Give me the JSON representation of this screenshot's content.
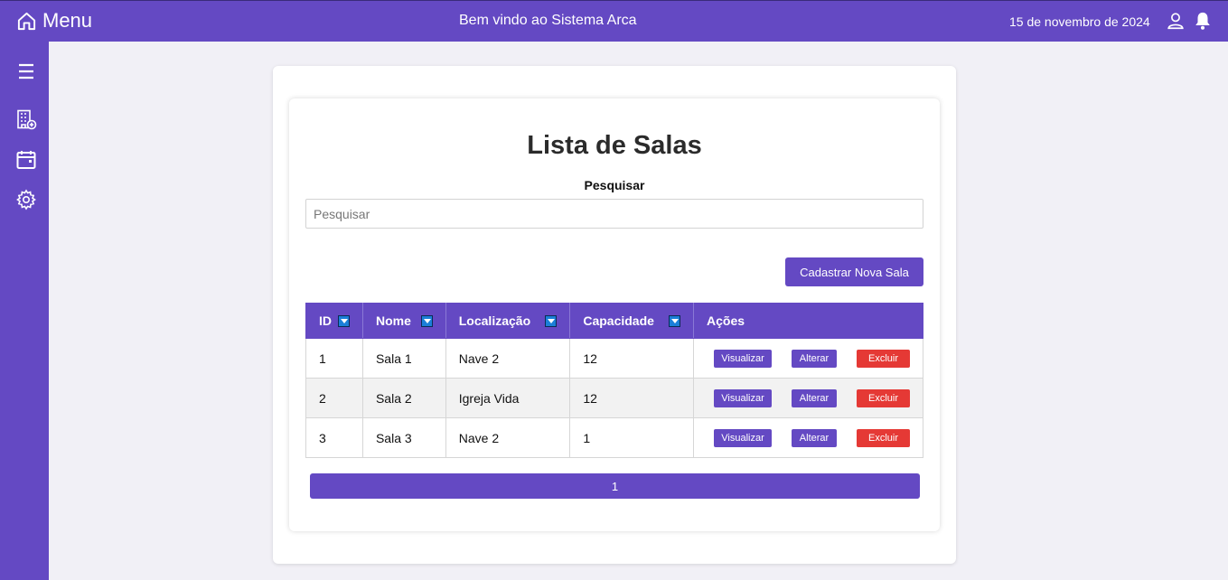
{
  "header": {
    "menu_label": "Menu",
    "welcome": "Bem vindo ao Sistema Arca",
    "date": "15 de novembro de 2024",
    "icons": [
      "home-icon",
      "user-icon",
      "bell-icon"
    ]
  },
  "sidebar": {
    "items": [
      {
        "icon": "hamburger-icon"
      },
      {
        "icon": "building-add-icon"
      },
      {
        "icon": "calendar-icon"
      },
      {
        "icon": "gear-icon"
      }
    ]
  },
  "main": {
    "title": "Lista de Salas",
    "search_label": "Pesquisar",
    "search_placeholder": "Pesquisar",
    "search_value": "",
    "new_button": "Cadastrar Nova Sala",
    "page": "1"
  },
  "table": {
    "headers": [
      "ID",
      "Nome",
      "Localização",
      "Capacidade",
      "Ações"
    ],
    "rows": [
      {
        "id": "1",
        "nome": "Sala 1",
        "localizacao": "Nave 2",
        "capacidade": "12"
      },
      {
        "id": "2",
        "nome": "Sala 2",
        "localizacao": "Igreja Vida",
        "capacidade": "12"
      },
      {
        "id": "3",
        "nome": "Sala 3",
        "localizacao": "Nave 2",
        "capacidade": "1"
      }
    ],
    "actions": {
      "view": "Visualizar",
      "edit": "Alterar",
      "delete": "Excluir"
    }
  },
  "colors": {
    "primary": "#6449c3",
    "danger": "#e53935",
    "background": "#f1f0f6"
  }
}
